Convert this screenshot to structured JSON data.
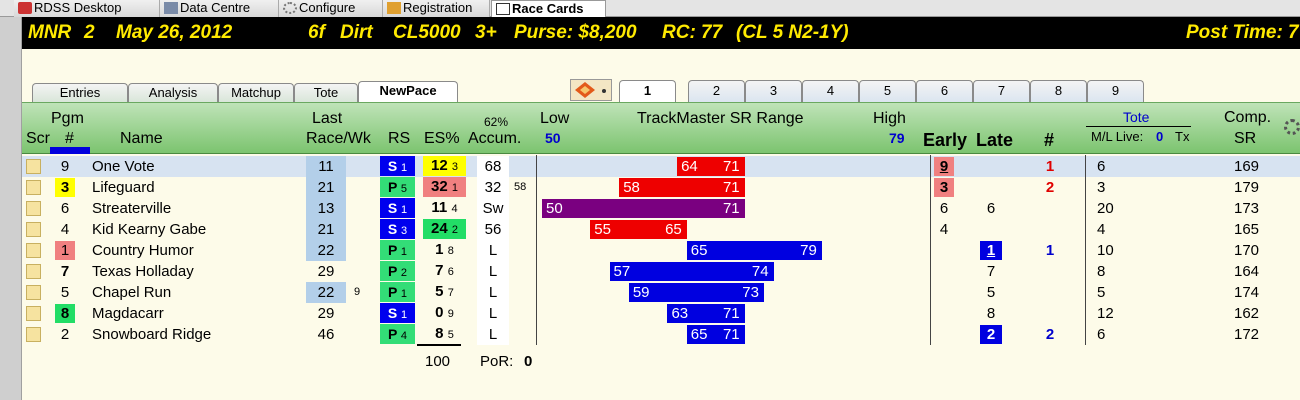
{
  "window_tabs": [
    {
      "label": "RDSS Desktop",
      "icon": "desktop-icon"
    },
    {
      "label": "Data Centre",
      "icon": "database-icon"
    },
    {
      "label": "Configure",
      "icon": "gear-icon"
    },
    {
      "label": "Registration",
      "icon": "registration-icon"
    },
    {
      "label": "Race Cards",
      "icon": "card-icon",
      "active": true
    }
  ],
  "header": {
    "track": "MNR",
    "race": "2",
    "date": "May 26, 2012",
    "distance": "6f",
    "surface": "Dirt",
    "class": "CL5000",
    "age": "3+",
    "purse": "Purse: $8,200",
    "rc": "RC: 77",
    "cond": "(CL 5 N2-1Y)",
    "post": "Post Time: 7"
  },
  "view_tabs": [
    "Entries",
    "Analysis",
    "Matchup",
    "Tote",
    "NewPace"
  ],
  "race_tabs": [
    "1",
    "2",
    "3",
    "4",
    "5",
    "6",
    "7",
    "8",
    "9"
  ],
  "columns": {
    "pgm": "Pgm",
    "scr": "Scr",
    "hash": "#",
    "name": "Name",
    "last": "Last",
    "racewk": "Race/Wk",
    "rs": "RS",
    "es": "ES%",
    "accum_pct": "62%",
    "accum": "Accum.",
    "low": "Low",
    "low_val": "50",
    "range": "TrackMaster SR Range",
    "high": "High",
    "high_val": "79",
    "early": "Early",
    "late": "Late",
    "num": "#",
    "tote": "Tote",
    "ml_live": "M/L Live:",
    "live_val": "0",
    "tx": "Tx",
    "comp": "Comp.",
    "sr": "SR"
  },
  "colors": {
    "rs_s": "#0000ee",
    "rs_p": "#33dd77",
    "bar_red": "#ee0000",
    "bar_purple": "#7a0080",
    "bar_blue": "#0000e0",
    "yellow": "#ffff00",
    "salmon": "#f08080",
    "green": "#22dd66"
  },
  "entries": [
    {
      "pgm": "9",
      "name": "One Vote",
      "last": "11",
      "lastnote": "",
      "rs": "S",
      "rsn": "1",
      "es": "12",
      "esn": "3",
      "acc": "68",
      "accnote": "",
      "low": "64",
      "high": "71",
      "early": "9",
      "late": "",
      "num": "1",
      "ml": "6",
      "comp": "169"
    },
    {
      "pgm": "3",
      "name": "Lifeguard",
      "last": "21",
      "lastnote": "",
      "rs": "P",
      "rsn": "5",
      "es": "32",
      "esn": "1",
      "acc": "32",
      "accnote": "58",
      "low": "58",
      "high": "71",
      "early": "3",
      "late": "",
      "num": "2",
      "ml": "3",
      "comp": "179"
    },
    {
      "pgm": "6",
      "name": "Streaterville",
      "last": "13",
      "lastnote": "",
      "rs": "S",
      "rsn": "1",
      "es": "11",
      "esn": "4",
      "acc": "Sw",
      "accnote": "",
      "low": "50",
      "high": "71",
      "early": "6",
      "late": "6",
      "num": "",
      "ml": "20",
      "comp": "173"
    },
    {
      "pgm": "4",
      "name": "Kid Kearny Gabe",
      "last": "21",
      "lastnote": "",
      "rs": "S",
      "rsn": "3",
      "es": "24",
      "esn": "2",
      "acc": "56",
      "accnote": "",
      "low": "55",
      "high": "65",
      "early": "4",
      "late": "",
      "num": "",
      "ml": "4",
      "comp": "165"
    },
    {
      "pgm": "1",
      "name": "Country Humor",
      "last": "22",
      "lastnote": "",
      "rs": "P",
      "rsn": "1",
      "es": "1",
      "esn": "8",
      "acc": "L",
      "accnote": "",
      "low": "65",
      "high": "79",
      "early": "",
      "late": "1",
      "num": "1",
      "ml": "10",
      "comp": "170"
    },
    {
      "pgm": "7",
      "name": "Texas Holladay",
      "last": "29",
      "lastnote": "",
      "rs": "P",
      "rsn": "2",
      "es": "7",
      "esn": "6",
      "acc": "L",
      "accnote": "",
      "low": "57",
      "high": "74",
      "early": "",
      "late": "7",
      "num": "",
      "ml": "8",
      "comp": "164"
    },
    {
      "pgm": "5",
      "name": "Chapel Run",
      "last": "22",
      "lastnote": "9",
      "rs": "P",
      "rsn": "1",
      "es": "5",
      "esn": "7",
      "acc": "L",
      "accnote": "",
      "low": "59",
      "high": "73",
      "early": "",
      "late": "5",
      "num": "",
      "ml": "5",
      "comp": "174"
    },
    {
      "pgm": "8",
      "name": "Magdacarr",
      "last": "29",
      "lastnote": "",
      "rs": "S",
      "rsn": "1",
      "es": "0",
      "esn": "9",
      "acc": "L",
      "accnote": "",
      "low": "63",
      "high": "71",
      "early": "",
      "late": "8",
      "num": "",
      "ml": "12",
      "comp": "162"
    },
    {
      "pgm": "2",
      "name": "Snowboard Ridge",
      "last": "46",
      "lastnote": "",
      "rs": "P",
      "rsn": "4",
      "es": "8",
      "esn": "5",
      "acc": "L",
      "accnote": "",
      "low": "65",
      "high": "71",
      "early": "",
      "late": "2",
      "num": "2",
      "ml": "6",
      "comp": "172"
    }
  ],
  "footer": {
    "total": "100",
    "por_label": "PoR:",
    "por": "0"
  }
}
